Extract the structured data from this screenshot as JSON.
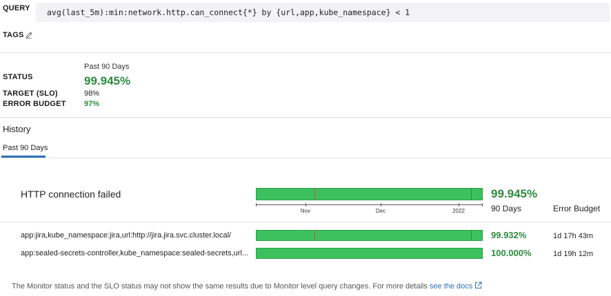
{
  "query": {
    "label": "QUERY",
    "text": "avg(last_5m):min:network.http.can_connect{*} by {url,app,kube_namespace} < 1"
  },
  "tags": {
    "label": "TAGS",
    "edit_icon": "pencil-icon"
  },
  "status": {
    "period": "Past 90 Days",
    "status_label": "STATUS",
    "status_value": "99.945%",
    "target_label": "TARGET (SLO)",
    "target_value": "98%",
    "budget_label": "ERROR BUDGET",
    "budget_value": "97%"
  },
  "history": {
    "title": "History",
    "tabs": [
      {
        "label": "Past 90 Days",
        "active": true
      }
    ]
  },
  "slo": {
    "name": "HTTP connection failed",
    "overall_pct": "99.945%",
    "col_days": "90 Days",
    "col_budget": "Error Budget",
    "axis_ticks": [
      "Nov",
      "Dec",
      "2022"
    ],
    "rows": [
      {
        "label": "app:jira,kube_namespace:jira,url:http://jira.jira.svc.cluster.local/",
        "pct": "99.932%",
        "budget": "1d 17h 43m"
      },
      {
        "label": "app:sealed-secrets-controller,kube_namespace:sealed-secrets,url...",
        "pct": "100.000%",
        "budget": "1d 19h 12m"
      }
    ]
  },
  "footer": {
    "text": "The Monitor status and the SLO status may not show the same results due to Monitor level query changes. For more details",
    "link": "see the docs",
    "link_icon": "external-link-icon"
  },
  "colors": {
    "accent": "#2c6fb7",
    "success": "#3cc15e",
    "error": "#d24d3c",
    "text_green": "#2d8a3f"
  }
}
